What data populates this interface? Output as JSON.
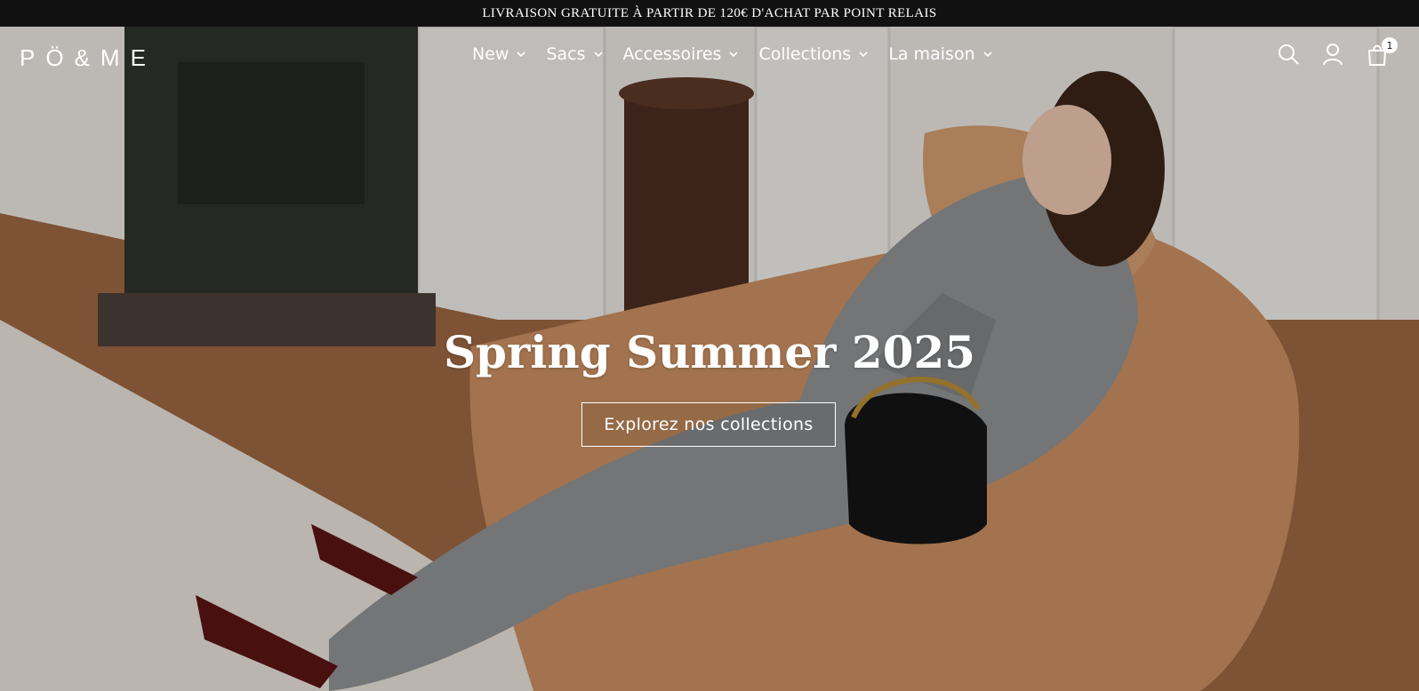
{
  "announcement": "LIVRAISON GRATUITE À PARTIR DE 120€ D'ACHAT PAR POINT RELAIS",
  "brand": {
    "logo_text": "PÖ&ME"
  },
  "nav": {
    "items": [
      {
        "label": "New"
      },
      {
        "label": "Sacs"
      },
      {
        "label": "Accessoires"
      },
      {
        "label": "Collections"
      },
      {
        "label": "La maison"
      }
    ]
  },
  "header_icons": [
    "search-icon",
    "account-icon",
    "cart-icon"
  ],
  "cart": {
    "count": "1"
  },
  "hero": {
    "title": "Spring Summer 2025",
    "cta_label": "Explorez nos collections"
  },
  "colors": {
    "announcement_bg": "#111111",
    "text_on_image": "#ffffff"
  }
}
